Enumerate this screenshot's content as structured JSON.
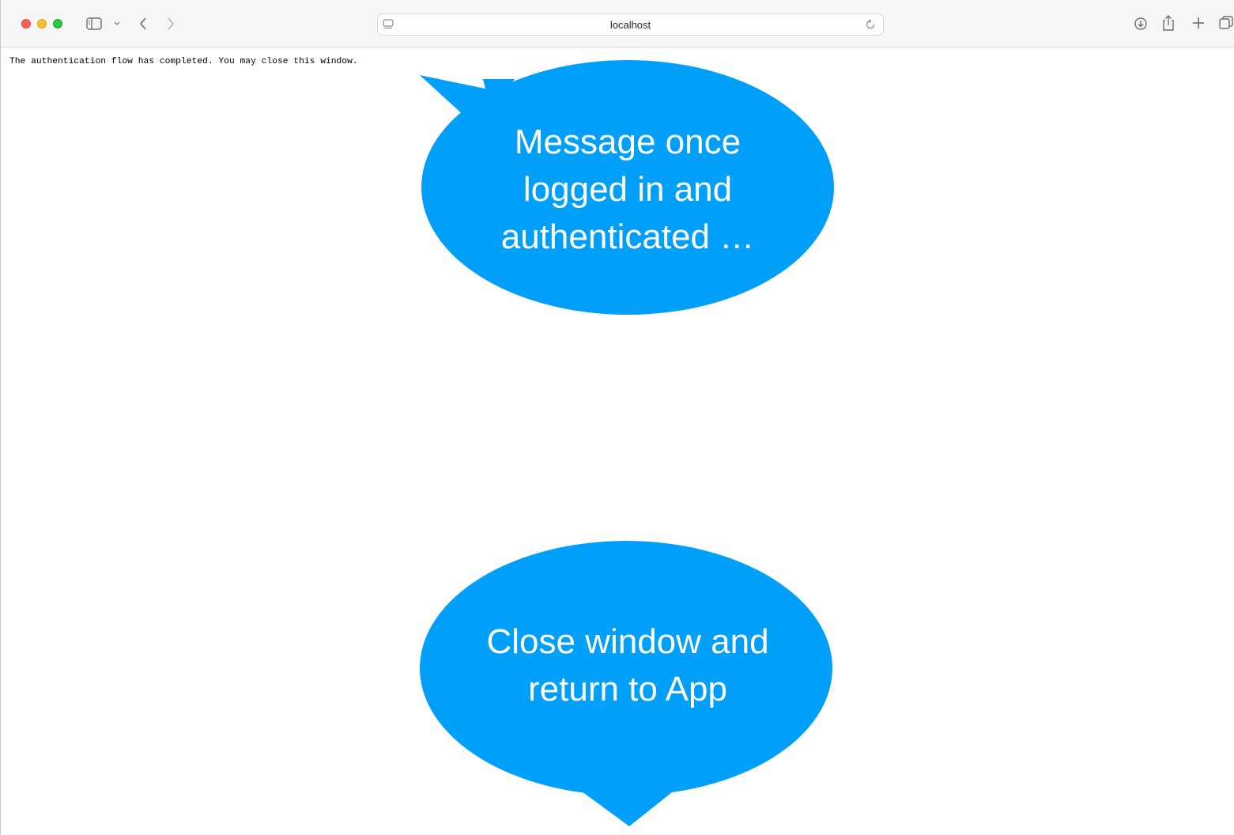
{
  "browser": {
    "url": "localhost",
    "icons": {
      "sidebar": "sidebar-icon",
      "chevron": "chevron-down-icon",
      "back": "back-arrow-icon",
      "forward": "forward-arrow-icon",
      "site": "site-info-icon",
      "reload": "reload-icon",
      "download": "download-icon",
      "share": "share-icon",
      "new_tab": "plus-icon",
      "tab_overview": "tab-overview-icon"
    },
    "colors": {
      "close": "#ff5f57",
      "minimize": "#febc2e",
      "zoom": "#28c840"
    }
  },
  "page": {
    "message": "The authentication flow has completed. You may close this window."
  },
  "callouts": [
    {
      "lines": [
        "Message once",
        "logged in and",
        "authenticated …"
      ],
      "color": "#00a0fa"
    },
    {
      "lines": [
        "Close window and",
        "return to App"
      ],
      "color": "#00a0fa"
    }
  ]
}
